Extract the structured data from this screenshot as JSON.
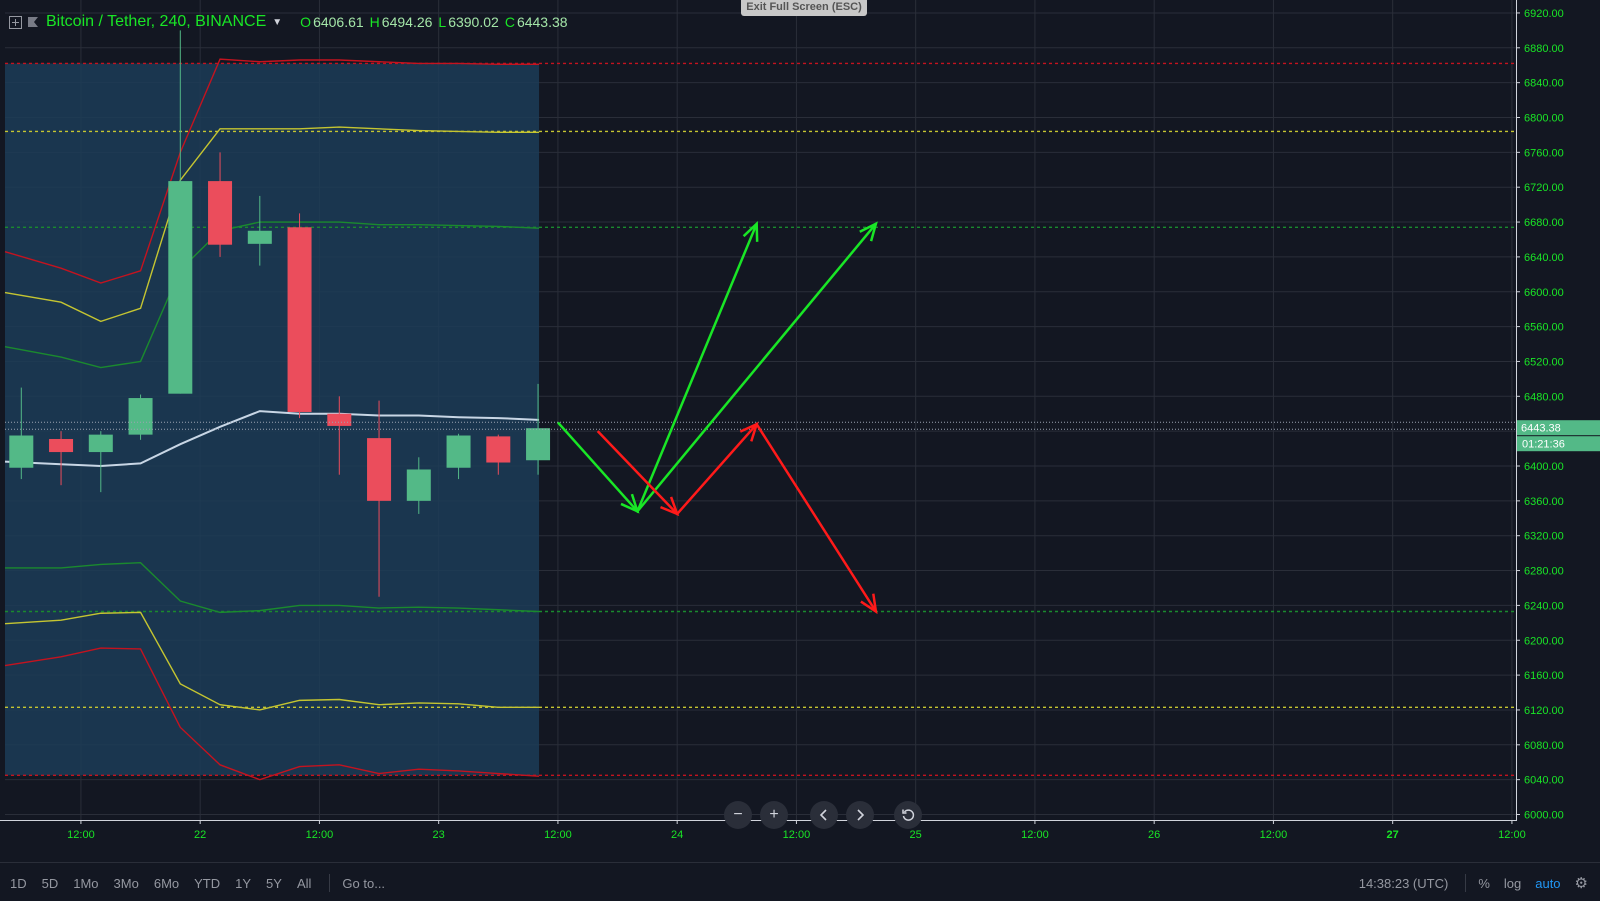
{
  "legend": {
    "symbol": "Bitcoin / Tether, 240, BINANCE",
    "open_label": "O",
    "open": "6406.61",
    "high_label": "H",
    "high": "6494.26",
    "low_label": "L",
    "low": "6390.02",
    "close_label": "C",
    "close": "6443.38"
  },
  "exit_fullscreen": "Exit Full Screen (ESC)",
  "price_tag": "6443.38",
  "countdown": "01:21:36",
  "bottom": {
    "ranges": [
      "1D",
      "5D",
      "1Mo",
      "3Mo",
      "6Mo",
      "YTD",
      "1Y",
      "5Y",
      "All"
    ],
    "goto": "Go to...",
    "clock": "14:38:23 (UTC)",
    "percent": "%",
    "log": "log",
    "auto": "auto"
  },
  "icons": {
    "add": "plus-square-icon",
    "flag": "flag-icon",
    "zoom_out": "minus-icon",
    "zoom_in": "plus-icon",
    "prev": "chevron-left-icon",
    "next": "chevron-right-icon",
    "reset": "reset-icon",
    "settings": "gear-icon"
  },
  "colors": {
    "background": "#131722",
    "up": "#53b987",
    "down": "#eb4d5c",
    "accent_green": "#19e626",
    "bb_red": "#c4131f",
    "bb_yellow": "#c5c531",
    "bb_green": "#1a8a2e",
    "basis": "#c8d6e5",
    "arrow_green": "#19e626",
    "arrow_red": "#ff1a1a",
    "shade": "#1c3c57"
  },
  "chart_data": {
    "type": "candlestick",
    "y_ticks": [
      "6920.00",
      "6880.00",
      "6840.00",
      "6800.00",
      "6760.00",
      "6720.00",
      "6680.00",
      "6640.00",
      "6600.00",
      "6560.00",
      "6520.00",
      "6480.00",
      "6440.00",
      "6400.00",
      "6360.00",
      "6320.00",
      "6280.00",
      "6240.00",
      "6200.00",
      "6160.00",
      "6120.00",
      "6080.00",
      "6040.00",
      "6000.00"
    ],
    "ylim": [
      6000,
      6920
    ],
    "x_ticks": [
      {
        "label": "12:00",
        "bar": 1.5
      },
      {
        "label": "22",
        "bar": 4.5
      },
      {
        "label": "12:00",
        "bar": 7.5
      },
      {
        "label": "23",
        "bar": 10.5
      },
      {
        "label": "12:00",
        "bar": 13.5
      },
      {
        "label": "24",
        "bar": 16.5
      },
      {
        "label": "12:00",
        "bar": 19.5
      },
      {
        "label": "25",
        "bar": 22.5
      },
      {
        "label": "12:00",
        "bar": 25.5
      },
      {
        "label": "26",
        "bar": 28.5
      },
      {
        "label": "12:00",
        "bar": 31.5
      },
      {
        "label": "27",
        "bar": 34.5,
        "highlight": true
      },
      {
        "label": "12:00",
        "bar": 37.5
      }
    ],
    "candles": [
      {
        "o": 6398,
        "h": 6490,
        "l": 6385,
        "c": 6435
      },
      {
        "o": 6431,
        "h": 6440,
        "l": 6378,
        "c": 6416
      },
      {
        "o": 6416,
        "h": 6440,
        "l": 6370,
        "c": 6436
      },
      {
        "o": 6436,
        "h": 6482,
        "l": 6430,
        "c": 6478
      },
      {
        "o": 6483,
        "h": 6900,
        "l": 6483,
        "c": 6727
      },
      {
        "o": 6727,
        "h": 6760,
        "l": 6640,
        "c": 6654
      },
      {
        "o": 6655,
        "h": 6710,
        "l": 6630,
        "c": 6670
      },
      {
        "o": 6674,
        "h": 6690,
        "l": 6455,
        "c": 6462
      },
      {
        "o": 6460,
        "h": 6480,
        "l": 6390,
        "c": 6446
      },
      {
        "o": 6432,
        "h": 6475,
        "l": 6250,
        "c": 6360
      },
      {
        "o": 6360,
        "h": 6410,
        "l": 6345,
        "c": 6396
      },
      {
        "o": 6398,
        "h": 6437,
        "l": 6385,
        "c": 6435
      },
      {
        "o": 6434,
        "h": 6436,
        "l": 6390,
        "c": 6404
      },
      {
        "o": 6406.61,
        "h": 6494.26,
        "l": 6390.02,
        "c": 6443.38
      }
    ],
    "bands": {
      "basis": [
        6405,
        6402,
        6400,
        6403,
        6425,
        6445,
        6463,
        6460,
        6460,
        6458,
        6458,
        6456,
        6455,
        6453
      ],
      "upper1": [
        6537,
        6525,
        6513,
        6520,
        6625,
        6670,
        6680,
        6680,
        6680,
        6677,
        6677,
        6676,
        6675,
        6673
      ],
      "upper2": [
        6599,
        6588,
        6566,
        6581,
        6728,
        6787,
        6787,
        6787,
        6789,
        6787,
        6785,
        6784,
        6783,
        6783
      ],
      "upper3": [
        6646,
        6627,
        6610,
        6624,
        6760,
        6867,
        6864,
        6866,
        6866,
        6864,
        6862,
        6862,
        6861,
        6861
      ],
      "lower1": [
        6283,
        6283,
        6287,
        6289,
        6245,
        6232,
        6234,
        6240,
        6240,
        6237,
        6238,
        6237,
        6235,
        6233
      ],
      "lower2": [
        6219,
        6223,
        6231,
        6232,
        6150,
        6126,
        6120,
        6131,
        6132,
        6126,
        6128,
        6127,
        6123,
        6123
      ],
      "lower3": [
        6171,
        6181,
        6191,
        6190,
        6100,
        6057,
        6040,
        6055,
        6057,
        6047,
        6052,
        6050,
        6047,
        6044
      ]
    },
    "levels": [
      {
        "price": 6862,
        "color": "red"
      },
      {
        "price": 6784,
        "color": "yellow"
      },
      {
        "price": 6674,
        "color": "green"
      },
      {
        "price": 6233,
        "color": "green"
      },
      {
        "price": 6123,
        "color": "yellow"
      },
      {
        "price": 6045,
        "color": "red"
      }
    ],
    "shade_bars": [
      0,
      13
    ],
    "last_price": 6443.38,
    "projections": {
      "green": [
        [
          13.5,
          6450
        ],
        [
          15.5,
          6348
        ],
        [
          21.5,
          6678
        ]
      ],
      "green_branch": [
        [
          15.5,
          6348
        ],
        [
          18.5,
          6678
        ]
      ],
      "red": [
        [
          14.5,
          6440
        ],
        [
          16.5,
          6345
        ],
        [
          18.5,
          6448
        ],
        [
          21.5,
          6233
        ]
      ]
    }
  }
}
